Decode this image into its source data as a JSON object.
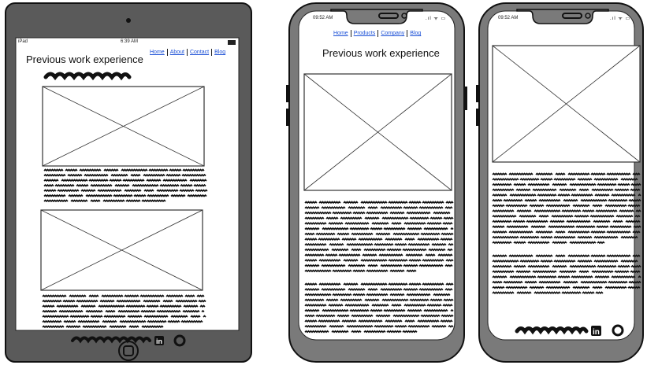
{
  "tablet": {
    "status": {
      "device": "iPad",
      "time": "6:39 AM"
    },
    "nav": [
      "Home",
      "About",
      "Contact",
      "Blog"
    ],
    "heading": "Previous work experience"
  },
  "phone1": {
    "status": {
      "time": "09:52 AM"
    },
    "nav": [
      "Home",
      "Products",
      "Company",
      "Blog"
    ],
    "heading": "Previous work experience"
  },
  "phone2": {
    "status": {
      "time": "09:52 AM"
    }
  },
  "icons": [
    "linkedin-icon",
    "github-icon",
    "home-button-icon",
    "wifi-icon",
    "battery-icon",
    "signal-icon"
  ],
  "colors": {
    "frame": "#555555",
    "bezel": "#777777",
    "link": "#1a4fd6",
    "ink": "#111111"
  }
}
